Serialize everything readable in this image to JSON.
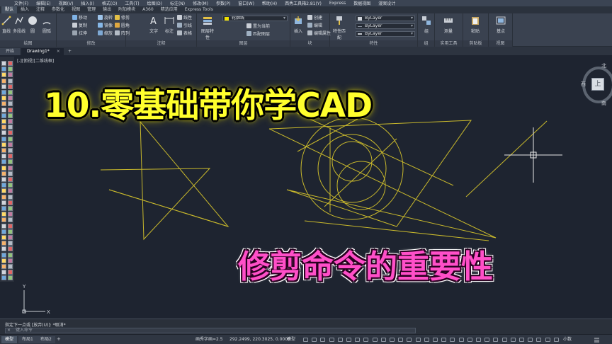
{
  "menu": [
    "文件(F)",
    "编辑(E)",
    "视图(V)",
    "插入(I)",
    "格式(O)",
    "工具(T)",
    "绘图(D)",
    "标注(N)",
    "修改(M)",
    "参数(P)",
    "窗口(W)",
    "帮助(H)",
    "西秀工具箱2.81(Y)",
    "Express",
    "数据视图",
    "漫案设计"
  ],
  "ribbon_tabs": [
    "默认",
    "插入",
    "注释",
    "参数化",
    "视图",
    "管理",
    "输出",
    "附加模块",
    "A360",
    "精选应用",
    "Express Tools"
  ],
  "ribbon": {
    "draw": {
      "title": "绘图",
      "line": "直线",
      "polyline": "多段线",
      "circle": "圆",
      "arc": "圆弧"
    },
    "modify": {
      "title": "修改",
      "move": "移动",
      "rotate": "旋转",
      "trim": "修剪",
      "copy": "复制",
      "mirror": "镜像",
      "fillet": "圆角",
      "stretch": "拉伸",
      "scale": "缩放",
      "array": "阵列"
    },
    "annotation": {
      "title": "注释",
      "text": "文字",
      "dim": "标注",
      "linear": "线性",
      "leader": "引线",
      "table": "表格"
    },
    "layers": {
      "title": "图层",
      "props": "图层特性",
      "layer_value": "轮廓线",
      "set_current": "置为当前",
      "match": "匹配图层"
    },
    "block": {
      "title": "块",
      "insert": "插入",
      "create": "创建",
      "edit": "编辑",
      "edit_attr": "编辑属性"
    },
    "properties": {
      "title": "特性",
      "match": "特性匹配",
      "bylayer1": "ByLayer",
      "bylayer2": "ByLayer",
      "bylayer3": "ByLayer"
    },
    "groups": {
      "title": "组",
      "group": "组"
    },
    "utilities": {
      "title": "实用工具",
      "measure": "测量"
    },
    "clipboard": {
      "title": "剪贴板",
      "paste": "粘贴"
    },
    "view": {
      "title": "视图",
      "base": "基点"
    }
  },
  "file_tabs": {
    "start": "开始",
    "drawing": "Drawing1*",
    "close": "×",
    "plus": "+"
  },
  "view_label": "[-][俯视][二维线框]",
  "viewcube": {
    "north": "北",
    "south": "南",
    "west": "西",
    "top": "上"
  },
  "overlay": {
    "title": "10.零基础带你学CAD",
    "subtitle": "修剪命令的重要性"
  },
  "command": {
    "history": "指定下一点或 [放弃(U)]: *取消*",
    "placeholder": "键入命令",
    "close": "×"
  },
  "status": {
    "model": "模型",
    "layout1": "布局1",
    "layout2": "布局2",
    "scale_label": "画秀字画=2.5",
    "coords": "292.2499, 220.3025, 0.0000",
    "space": "模型",
    "decimal": "小数"
  },
  "colors": {
    "canvas": "#1e2430",
    "geometry": "#c9b92c",
    "title": "#ffff2d",
    "subtitle": "#ff4fc8",
    "crosshair": "#e8e8e8"
  }
}
